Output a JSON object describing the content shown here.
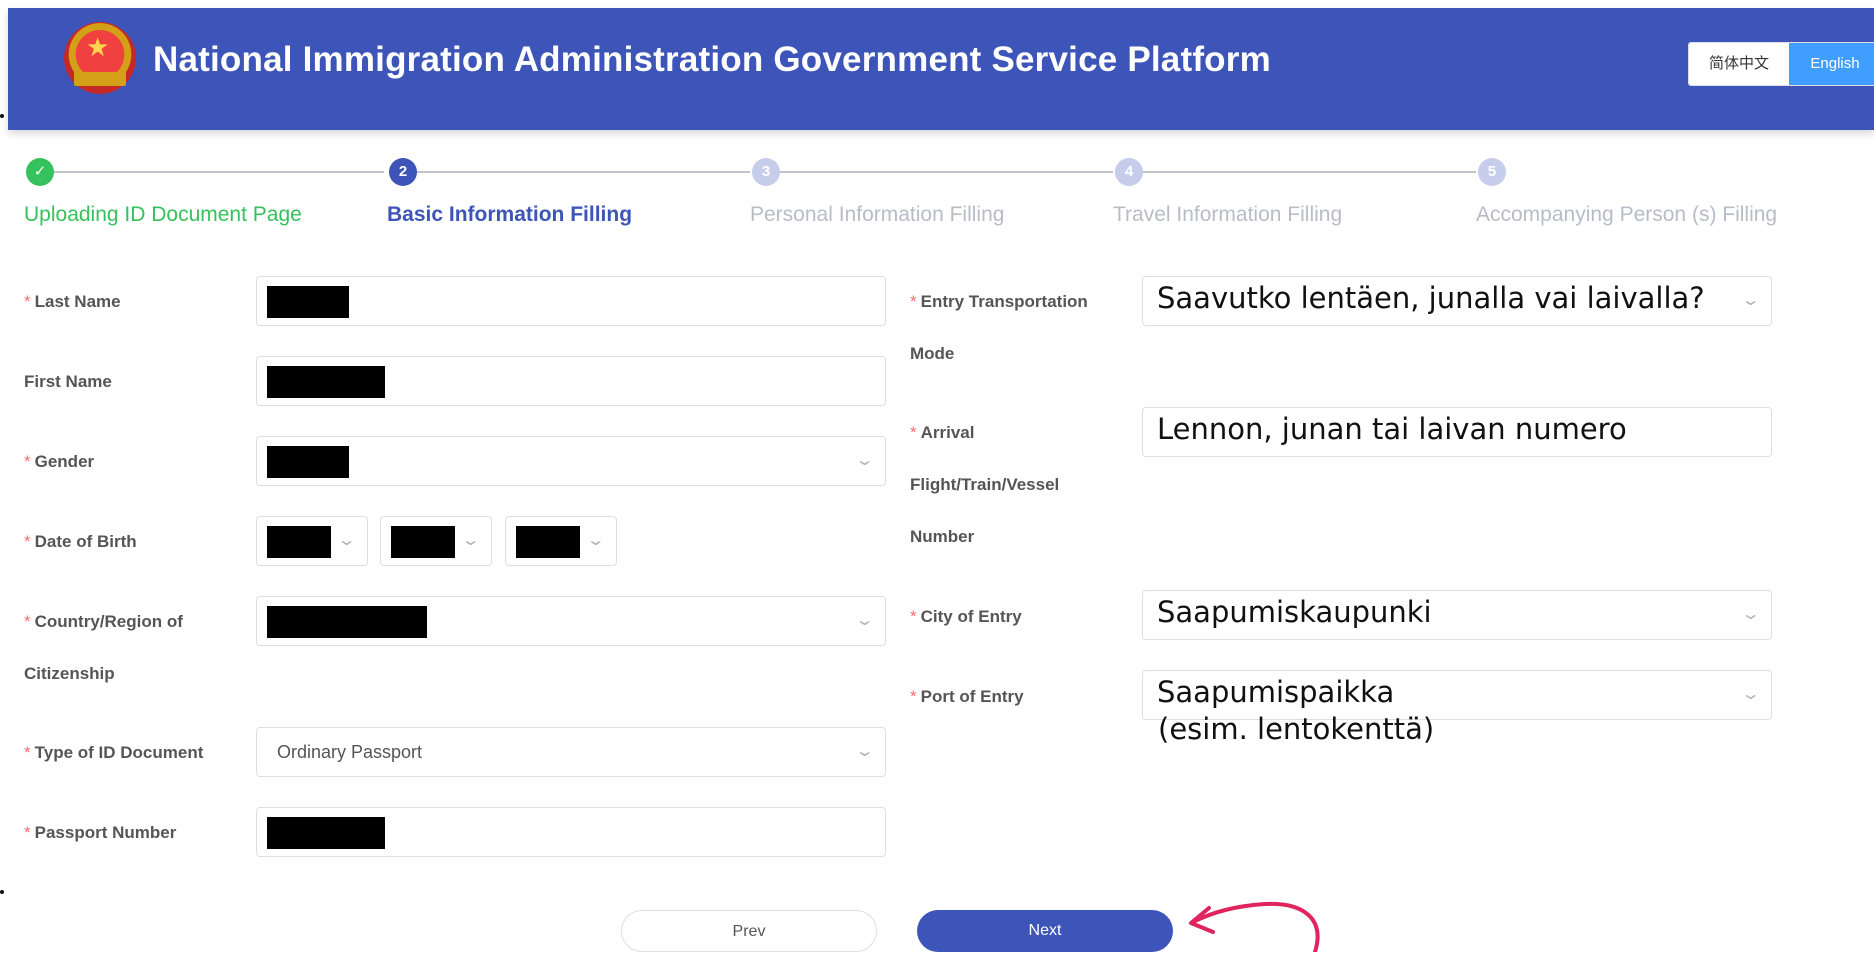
{
  "header": {
    "title": "National Immigration Administration Government Service Platform",
    "lang_zh": "简体中文",
    "lang_en": "English",
    "color": "#3d55b8"
  },
  "steps": [
    {
      "number": "✓",
      "label": "Uploading ID Document Page",
      "state": "done"
    },
    {
      "number": "2",
      "label": "Basic Information Filling",
      "state": "active"
    },
    {
      "number": "3",
      "label": "Personal Information Filling",
      "state": "wait"
    },
    {
      "number": "4",
      "label": "Travel Information Filling",
      "state": "wait"
    },
    {
      "number": "5",
      "label": "Accompanying Person (s) Filling",
      "state": "wait"
    }
  ],
  "left_form": {
    "last_name": {
      "label": "Last Name",
      "required": "*"
    },
    "first_name": {
      "label": "First Name"
    },
    "gender": {
      "label": "Gender",
      "required": "*"
    },
    "dob": {
      "label": "Date of Birth",
      "required": "*"
    },
    "citizenship": {
      "label_line1": "Country/Region of",
      "label_line2": "Citizenship",
      "required": "*"
    },
    "id_type": {
      "label": "Type of ID Document",
      "required": "*",
      "value": "Ordinary Passport"
    },
    "passport": {
      "label": "Passport Number",
      "required": "*"
    }
  },
  "right_form": {
    "transport": {
      "label_line1": "Entry Transportation",
      "label_line2": "Mode",
      "required": "*",
      "overlay": "Saavutko lentäen, junalla vai laivalla?"
    },
    "arrival": {
      "label_line1": "Arrival",
      "label_line2": "Flight/Train/Vessel",
      "label_line3": "Number",
      "required": "*",
      "overlay": "Lennon, junan tai laivan numero"
    },
    "city": {
      "label": "City of Entry",
      "required": "*",
      "overlay": "Saapumiskaupunki"
    },
    "port": {
      "label": "Port of Entry",
      "required": "*",
      "overlay_line1": "Saapumispaikka",
      "overlay_line2": "(esim. lentokenttä)"
    }
  },
  "buttons": {
    "prev": "Prev",
    "next": "Next"
  },
  "colors": {
    "success": "#35c15b",
    "primary": "#3d55b8",
    "required": "#f56c6c",
    "annotation": "#e0245e"
  }
}
